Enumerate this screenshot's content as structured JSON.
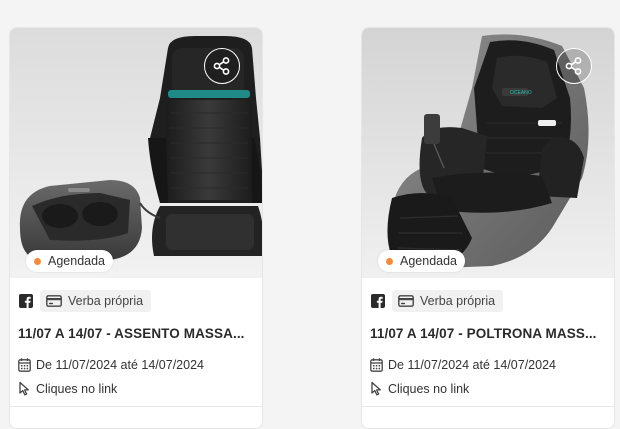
{
  "colors": {
    "status_scheduled": "#f08a3c",
    "card_bg": "#ffffff",
    "page_bg": "#f4f4f5"
  },
  "cards": [
    {
      "product": "massage-seat-and-foot-massager",
      "status": "Agendada",
      "platform_icon": "facebook-icon",
      "budget": "Verba própria",
      "title": "11/07 A 14/07 - ASSENTO MASSA...",
      "date_range": "De 11/07/2024 até 14/07/2024",
      "objective": "Cliques no link"
    },
    {
      "product": "massage-chair",
      "status": "Agendada",
      "platform_icon": "facebook-icon",
      "budget": "Verba própria",
      "title": "11/07 A 14/07 - POLTRONA MASS...",
      "date_range": "De 11/07/2024 até 14/07/2024",
      "objective": "Cliques no link"
    }
  ]
}
